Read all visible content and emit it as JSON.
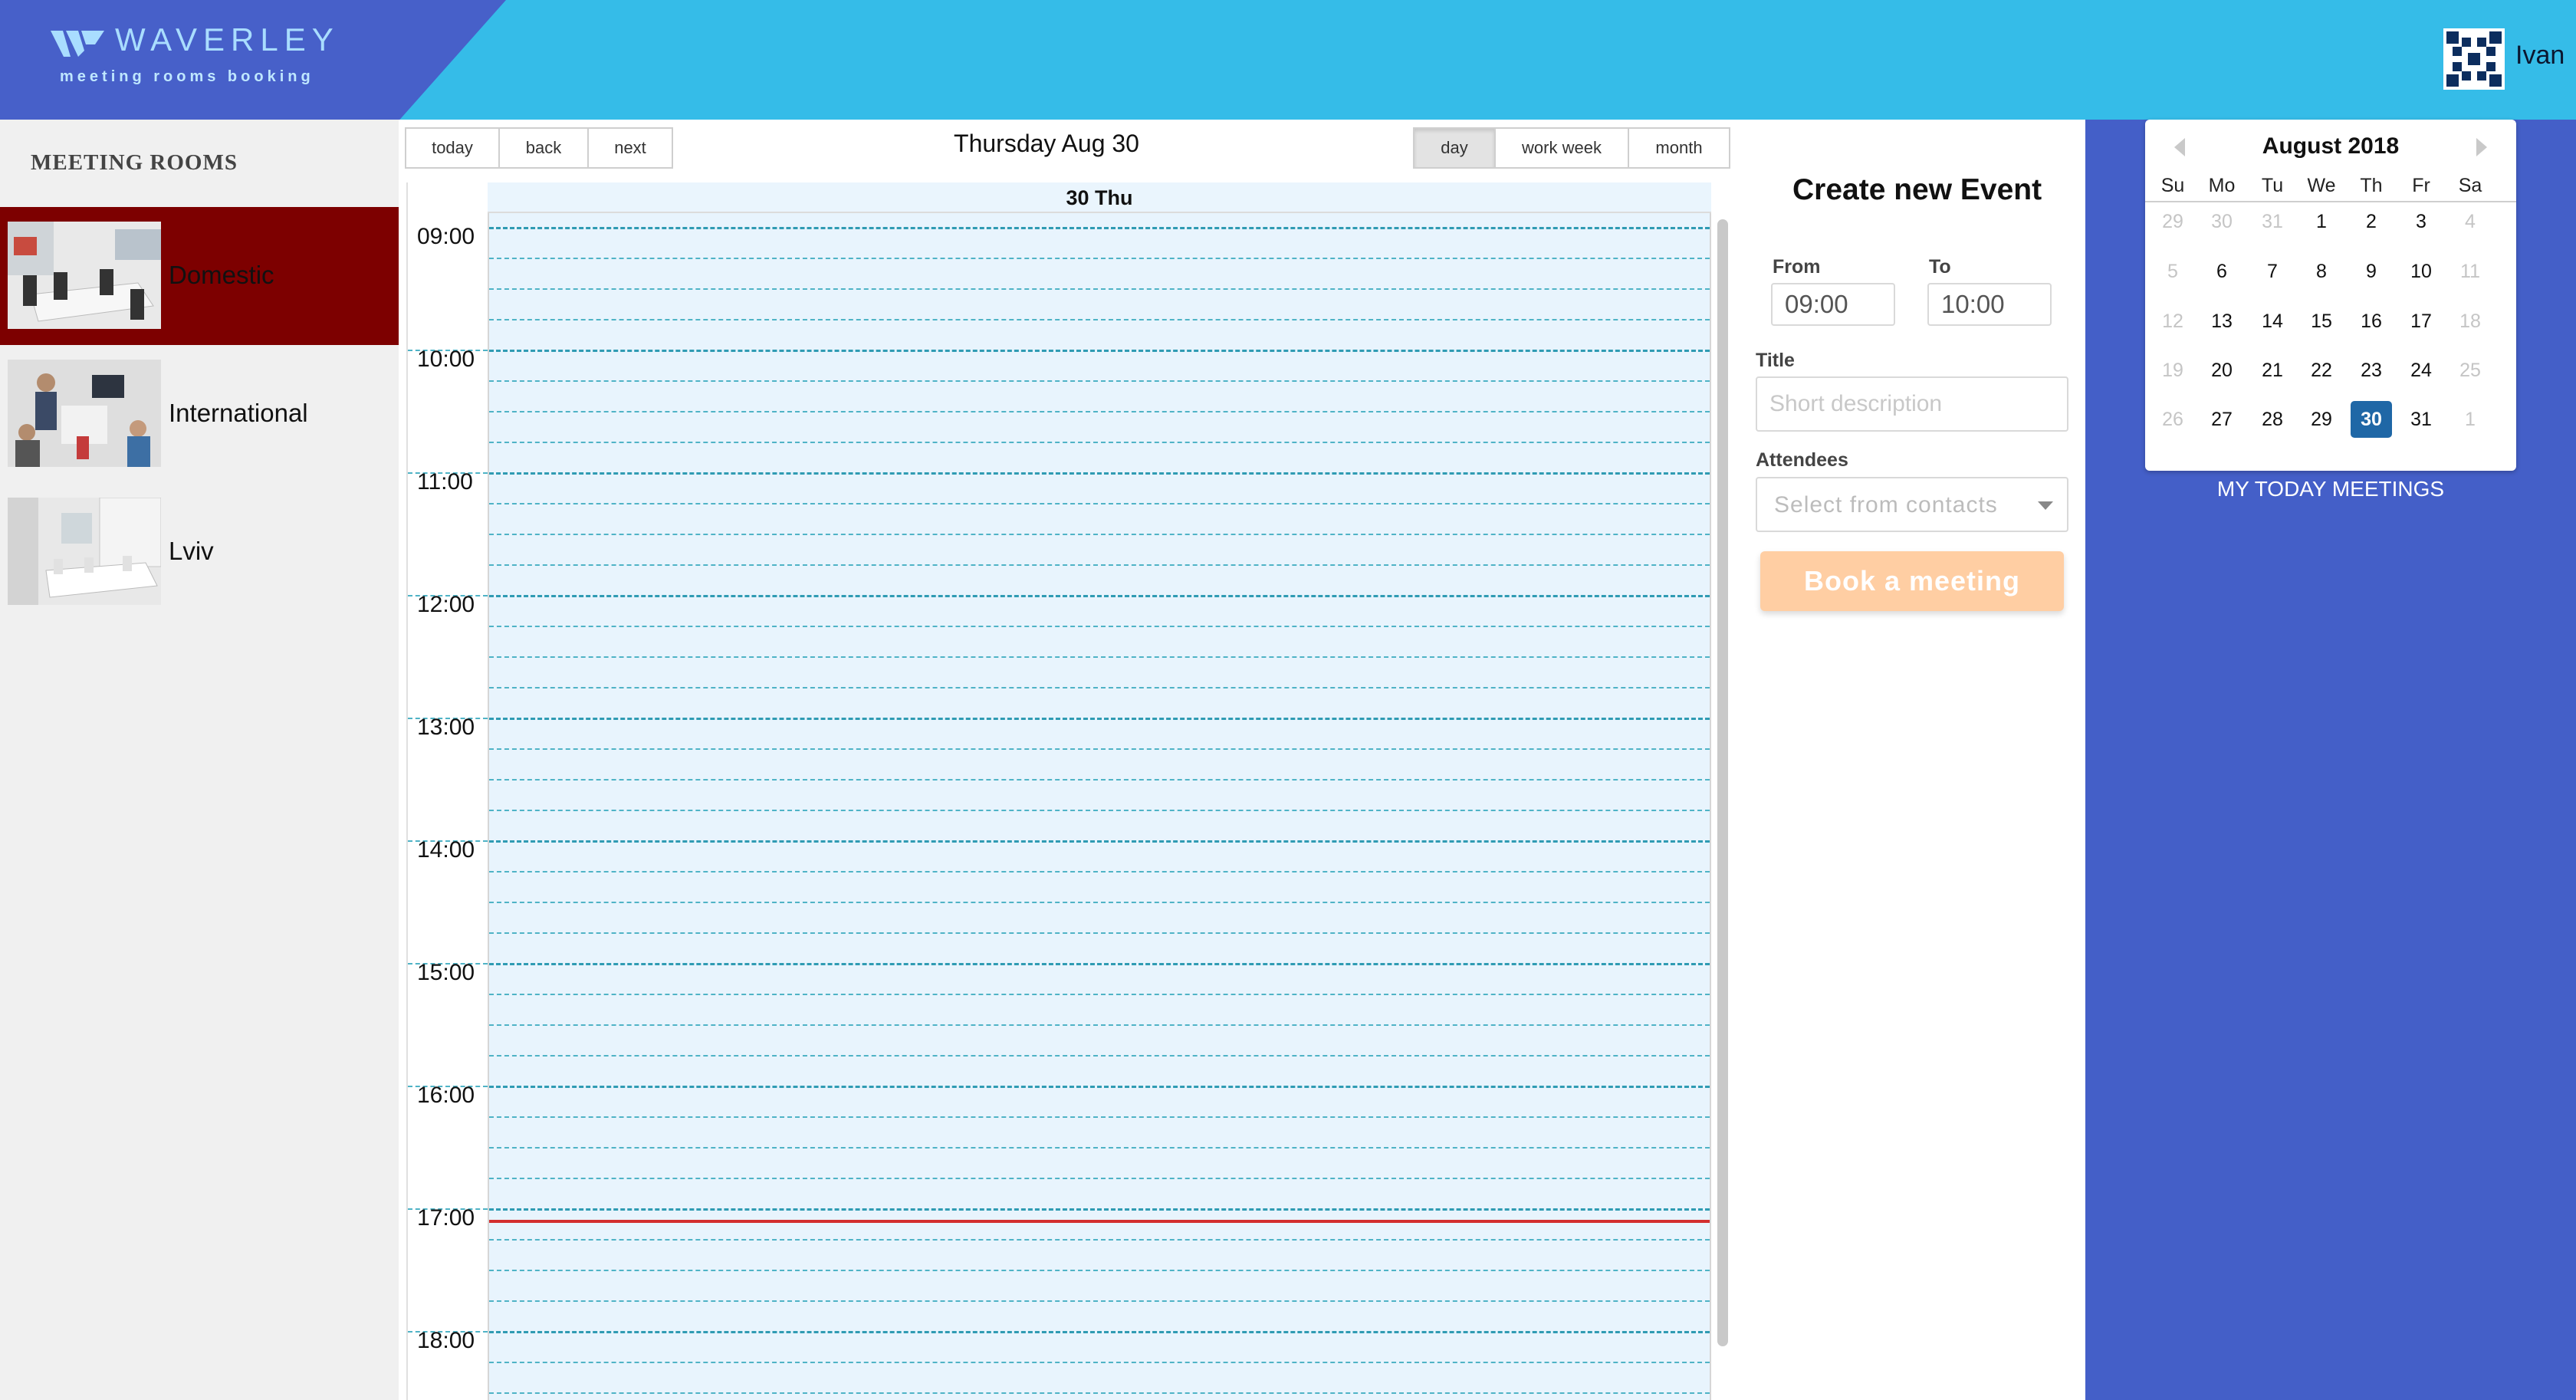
{
  "brand": {
    "name": "WAVERLEY",
    "tagline": "meeting rooms booking"
  },
  "user": {
    "name": "Ivan"
  },
  "rooms": {
    "title": "MEETING ROOMS",
    "items": [
      {
        "label": "Domestic",
        "active": true
      },
      {
        "label": "International",
        "active": false
      },
      {
        "label": "Lviv",
        "active": false
      }
    ]
  },
  "toolbar": {
    "today": "today",
    "back": "back",
    "next": "next",
    "day": "day",
    "work_week": "work week",
    "month": "month",
    "active_view": "day"
  },
  "calendar": {
    "current_date": "Thursday Aug 30",
    "day_header": "30 Thu",
    "hours": [
      "09:00",
      "10:00",
      "11:00",
      "12:00",
      "13:00",
      "14:00",
      "15:00",
      "16:00",
      "17:00",
      "18:00"
    ]
  },
  "form": {
    "title": "Create new Event",
    "from_label": "From",
    "from_value": "09:00",
    "to_label": "To",
    "to_value": "10:00",
    "title_label": "Title",
    "title_placeholder": "Short description",
    "attendees_label": "Attendees",
    "attendees_placeholder": "Select from contacts",
    "book_button": "Book a meeting"
  },
  "mini_calendar": {
    "month_label": "August 2018",
    "weekdays": [
      "Su",
      "Mo",
      "Tu",
      "We",
      "Th",
      "Fr",
      "Sa"
    ],
    "weeks": [
      [
        "29",
        "30",
        "31",
        "1",
        "2",
        "3",
        "4"
      ],
      [
        "5",
        "6",
        "7",
        "8",
        "9",
        "10",
        "11"
      ],
      [
        "12",
        "13",
        "14",
        "15",
        "16",
        "17",
        "18"
      ],
      [
        "19",
        "20",
        "21",
        "22",
        "23",
        "24",
        "25"
      ],
      [
        "26",
        "27",
        "28",
        "29",
        "30",
        "31",
        "1"
      ]
    ],
    "selected": "30"
  },
  "my_meetings": "MY TODAY MEETINGS",
  "colors": {
    "header": "#35bce8",
    "brand": "#4760c9",
    "room_active": "#7d0000",
    "panel_blue": "#445fc8",
    "book_button": "#ffcea3",
    "now_line": "#d32f2f"
  }
}
